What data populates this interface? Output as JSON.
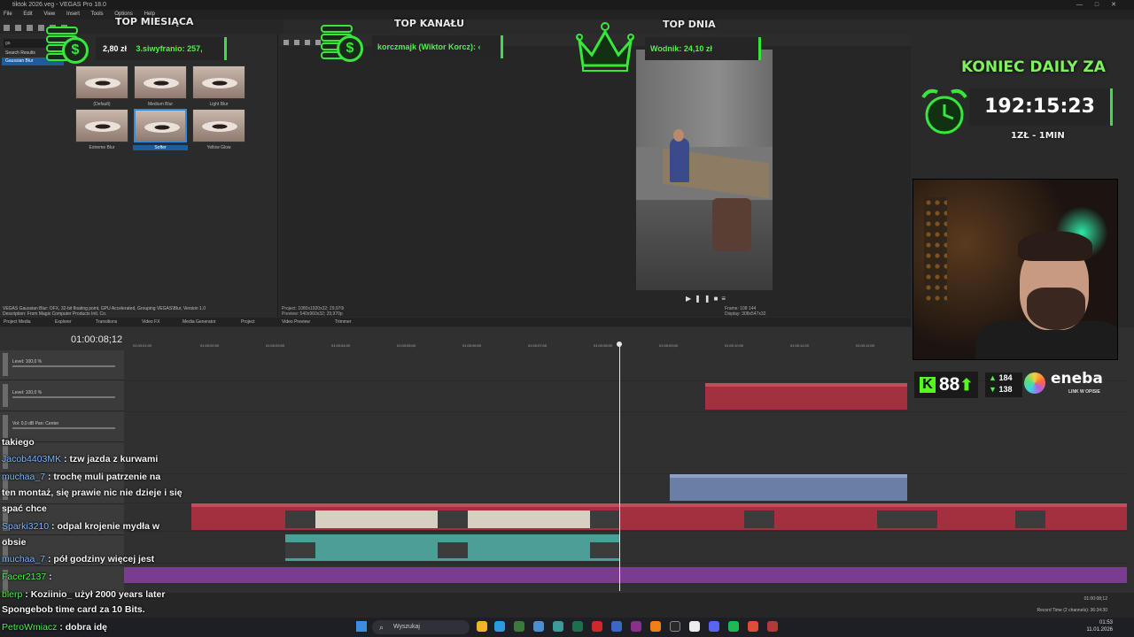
{
  "window": {
    "title": "tiktok 2026.veg - VEGAS Pro 18.0",
    "menu": [
      "File",
      "Edit",
      "View",
      "Insert",
      "Tools",
      "Options",
      "Help"
    ]
  },
  "fx_panel": {
    "search_value": "ga",
    "tree": [
      "Search Results",
      "Gaussian Blur"
    ],
    "presets": [
      "(Default)",
      "Medium Blur",
      "Light Blur",
      "Extreme Blur",
      "Softer",
      "Yellow Glow"
    ],
    "selected_preset": "Softer",
    "description_line1": "VEGAS Gaussian Blur: OFX, 32-bit floating point, GPU Accelerated, Grouping VEGAS\\Blur, Version 1.0",
    "description_line2": "Description: From Magix Computer Products Intl. Co."
  },
  "preview": {
    "project_line": "Project:   1080x1920x32; 29,970i",
    "preview_line": "Preview:  540x960x32; 29,970p",
    "frame_line": "Frame:     108 144",
    "display_line": "Display:   308x547x32"
  },
  "dock_tabs": [
    "Project Media",
    "Explorer",
    "Transitions",
    "Video FX",
    "Media Generator",
    "Project",
    "Video Preview",
    "Trimmer"
  ],
  "timeline": {
    "timecode": "01:00:08;12",
    "ruler": [
      "01:00:01;00",
      "01:00:02;00",
      "01:00:03;00",
      "01:00:04;00",
      "01:00:05;00",
      "01:00:06;00",
      "01:00:07;00",
      "01:00:08;00",
      "01:00:09;00",
      "01:00:10;00",
      "01:00:11;00",
      "01:00:12;00"
    ],
    "level_label": "Level: 100,0 %",
    "vol_label": "Vol:",
    "vol_value": "0,0 dB",
    "pan_label": "Pan:",
    "pan_value": "Center",
    "status_time": "01:00:08;12",
    "record_time": "Record Time (2 channels): 36:34:30"
  },
  "overlay": {
    "top_month_title": "TOP MIESIĄCA",
    "top_month_amount": "2,80 zł",
    "top_month_user": "3.siwyfranio: 257,",
    "top_channel_title": "TOP KANAŁU",
    "top_channel_user": "korczmajk (Wiktor Korcz): ‹",
    "top_day_title": "TOP DNIA",
    "top_day_user": "Wodnik: 24,10 zł",
    "daily_title": "KONIEC DAILY ZA",
    "timer": "192:15:23",
    "rate": "1ZŁ - 1MIN",
    "coin_symbol": "$",
    "kick_viewers": "88",
    "stat_up": "184",
    "stat_down": "138",
    "sponsor": "eneba",
    "sponsor_sub": "LINK W OPISIE",
    "accent": "#39e23f"
  },
  "chat": [
    {
      "user": "",
      "msg": "takiego",
      "color": "#ffffff"
    },
    {
      "user": "Jacob4403MK",
      "msg": " : tzw jazda z kurwami",
      "color": "#79b6ff"
    },
    {
      "user": "muchaa_7",
      "msg": " : trochę muli patrzenie na",
      "color": "#79b6ff"
    },
    {
      "user": "",
      "msg": "ten montaż, się prawie nic nie dzieje i się",
      "color": "#ffffff"
    },
    {
      "user": "",
      "msg": "spać chce",
      "color": "#ffffff"
    },
    {
      "user": "Sparki3210",
      "msg": " : odpal krojenie mydła w",
      "color": "#79b6ff"
    },
    {
      "user": "",
      "msg": "obsie",
      "color": "#ffffff"
    },
    {
      "user": "muchaa_7",
      "msg": " : pół godziny więcej jest",
      "color": "#79b6ff"
    },
    {
      "user": "Facer2137",
      "msg": " :",
      "color": "#4df24a"
    },
    {
      "user": "blerp",
      "msg": " : Koziinio_ użył 2000 years later",
      "color": "#4df24a"
    },
    {
      "user": "",
      "msg": "Spongebob time card za 10 Bits.",
      "color": "#ffffff"
    },
    {
      "user": "PetroWmiacz",
      "msg": " : dobra idę",
      "color": "#4df24a"
    }
  ],
  "taskbar": {
    "search_placeholder": "Wyszukaj",
    "time": "01:53",
    "date": "11.01.2026"
  }
}
